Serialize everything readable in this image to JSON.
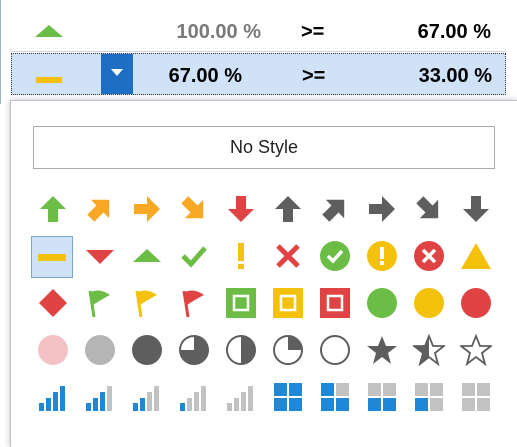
{
  "rows": [
    {
      "icon": "triangle-up-icon",
      "value1": "100.00 %",
      "operator": ">=",
      "value2": "67.00 %",
      "selected": false
    },
    {
      "icon": "dash-icon",
      "value1": "67.00 %",
      "operator": ">=",
      "value2": "33.00 %",
      "selected": true
    }
  ],
  "popup": {
    "no_style_label": "No Style",
    "icons": [
      [
        "arrow-up-green-icon",
        "arrow-up-right-orange-icon",
        "arrow-right-orange-icon",
        "arrow-down-right-orange-icon",
        "arrow-down-red-icon",
        "arrow-up-gray-icon",
        "arrow-up-right-gray-icon",
        "arrow-right-gray-icon",
        "arrow-down-right-gray-icon",
        "arrow-down-gray-icon"
      ],
      [
        "dash-yellow-icon",
        "triangle-down-red-icon",
        "triangle-up-green-icon",
        "checkmark-green-icon",
        "exclamation-yellow-icon",
        "cross-red-icon",
        "check-circle-green-icon",
        "exclamation-circle-yellow-icon",
        "cross-circle-red-icon",
        "triangle-yellow-icon"
      ],
      [
        "diamond-red-icon",
        "flag-green-icon",
        "flag-yellow-icon",
        "flag-red-icon",
        "square-green-icon",
        "square-yellow-icon",
        "square-red-icon",
        "circle-green-icon",
        "circle-yellow-icon",
        "circle-red-icon"
      ],
      [
        "circle-pink-icon",
        "circle-lightgray-icon",
        "circle-darkgray-icon",
        "pie-three-quarter-icon",
        "pie-half-icon",
        "pie-quarter-icon",
        "circle-empty-icon",
        "star-full-icon",
        "star-half-icon",
        "star-empty-icon"
      ],
      [
        "signal-4-bars-icon",
        "signal-3-bars-icon",
        "signal-2-bars-icon",
        "signal-1-bar-icon",
        "signal-0-bars-icon",
        "quad-4-icon",
        "quad-3-icon",
        "quad-2-icon",
        "quad-1-icon",
        "quad-0-icon"
      ]
    ]
  },
  "colors": {
    "green": "#6cbd45",
    "orange": "#f9a825",
    "yellow": "#f4c20d",
    "red": "#e04343",
    "gray": "#5e5e5e",
    "blue": "#1e88d6",
    "selection": "#cfe2f7",
    "value1_row1": "#7a7a7a"
  }
}
